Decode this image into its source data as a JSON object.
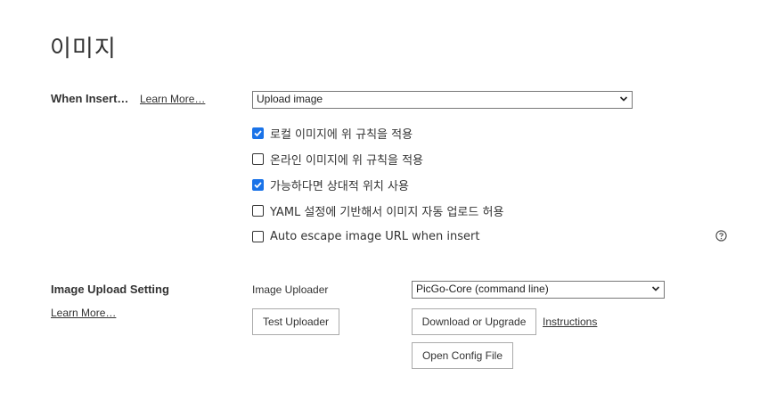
{
  "page_title": "이미지",
  "when_insert": {
    "label": "When Insert…",
    "learn_more": "Learn More…",
    "select_value": "Upload image",
    "checkboxes": [
      {
        "label": "로컬 이미지에 위 규칙을 적용",
        "checked": true
      },
      {
        "label": "온라인 이미지에 위 규칙을 적용",
        "checked": false
      },
      {
        "label": "가능하다면 상대적 위치 사용",
        "checked": true
      },
      {
        "label": "YAML 설정에 기반해서 이미지 자동 업로드 허용",
        "checked": false
      },
      {
        "label": "Auto escape image URL when insert",
        "checked": false
      }
    ],
    "help_icon": "question-circle-icon"
  },
  "upload_setting": {
    "label": "Image Upload Setting",
    "learn_more": "Learn More…",
    "uploader_label": "Image Uploader",
    "uploader_value": "PicGo-Core (command line)",
    "test_button": "Test Uploader",
    "download_button": "Download or Upgrade",
    "instructions_link": "Instructions",
    "config_button": "Open Config File"
  },
  "colors": {
    "checkbox_checked": "#1a73e8",
    "text": "#333333"
  }
}
